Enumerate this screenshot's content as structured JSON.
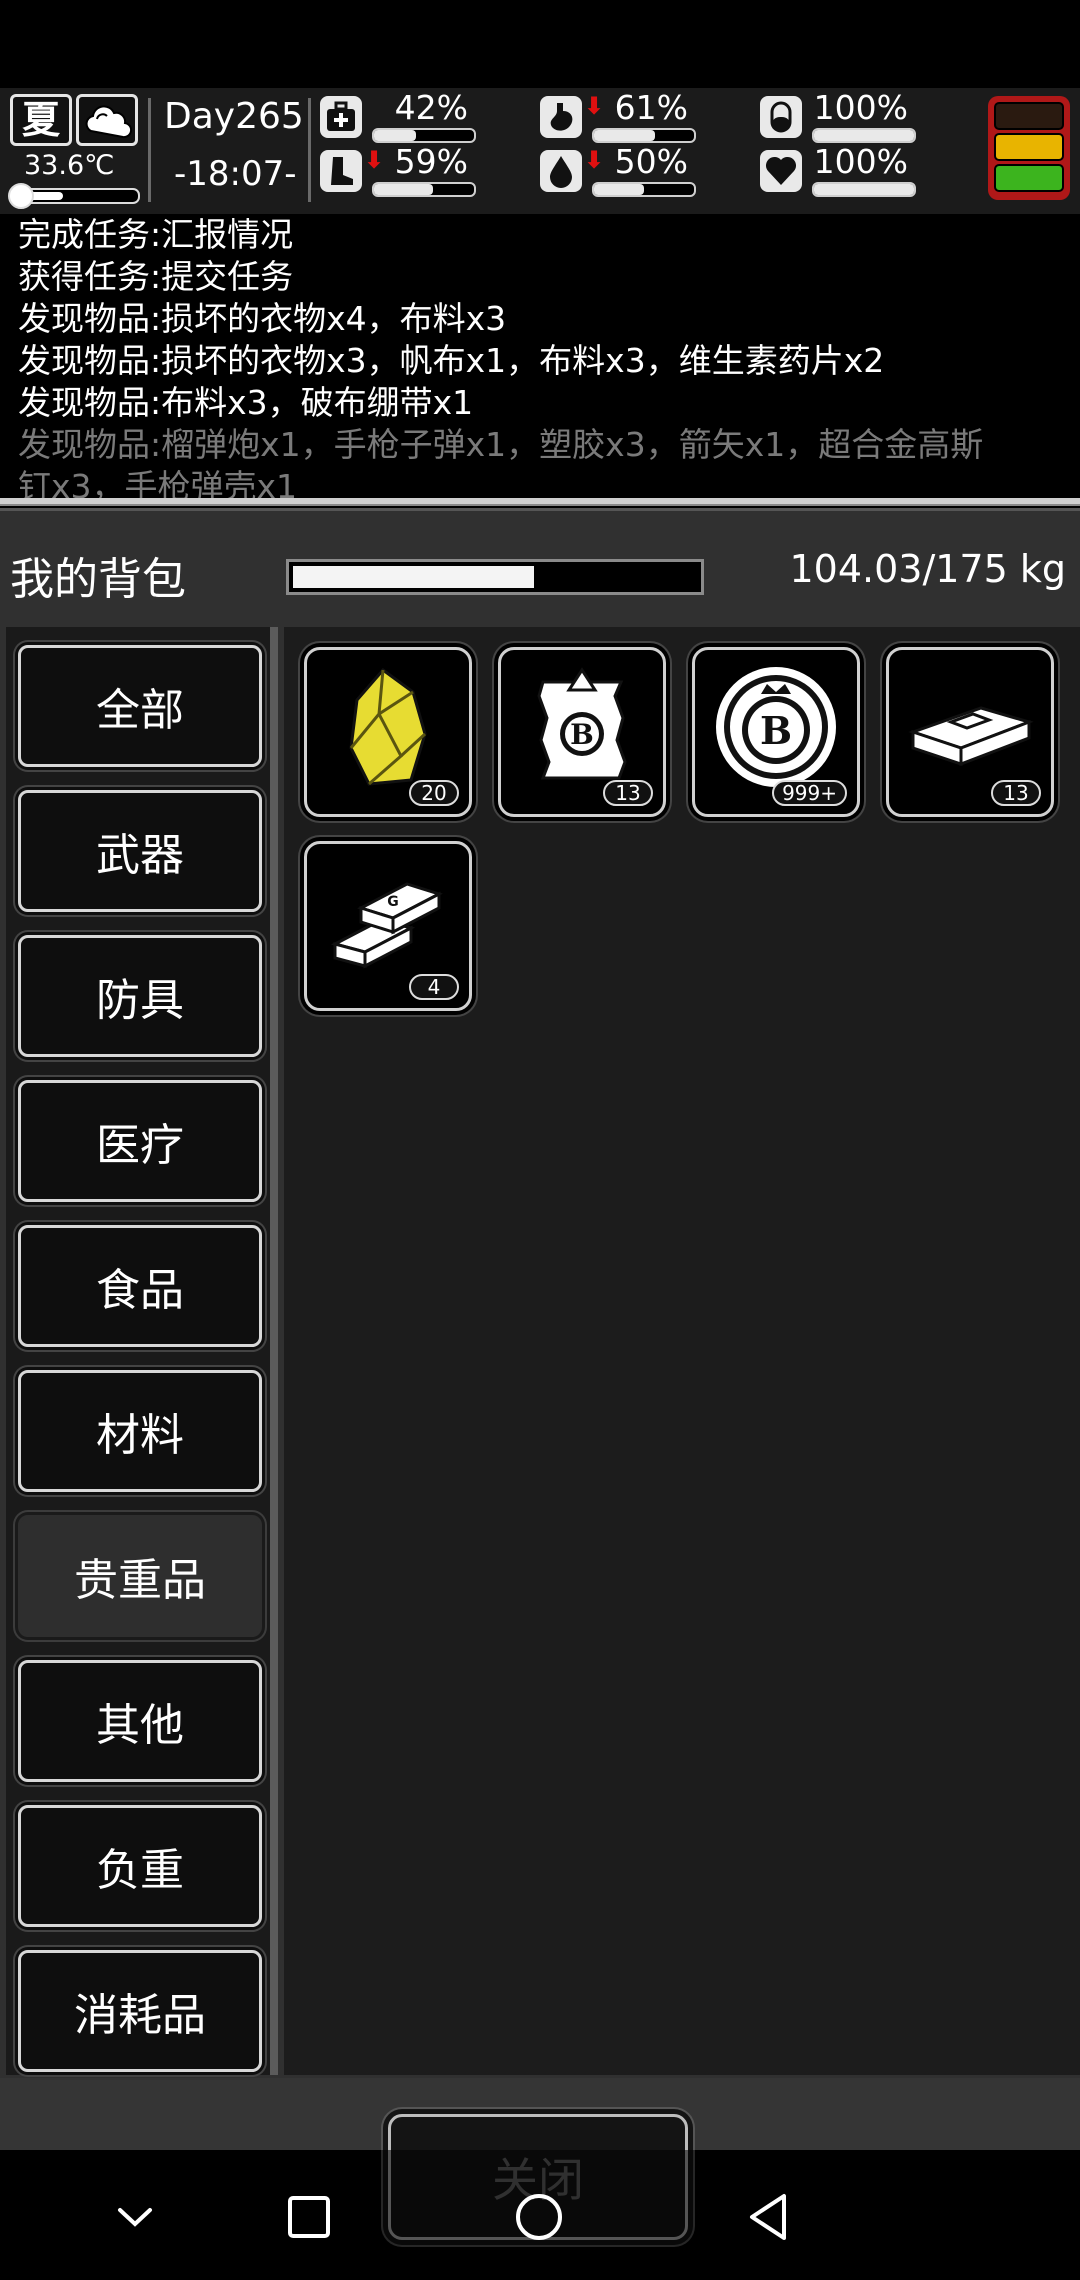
{
  "hud": {
    "season": "夏",
    "temperature": "33.6℃",
    "temperature_level": 0.4,
    "day": "Day265",
    "time": "-18:07-",
    "stats": [
      {
        "name": "health",
        "icon": "medkit-icon",
        "value": "42%",
        "level": 0.42,
        "dropping": false
      },
      {
        "name": "hunger",
        "icon": "stomach-icon",
        "value": "61%",
        "level": 0.61,
        "dropping": true
      },
      {
        "name": "medicine",
        "icon": "pill-icon",
        "value": "100%",
        "level": 1.0,
        "dropping": false
      },
      {
        "name": "stamina",
        "icon": "boot-icon",
        "value": "59%",
        "level": 0.59,
        "dropping": true
      },
      {
        "name": "thirst",
        "icon": "water-drop-icon",
        "value": "50%",
        "level": 0.5,
        "dropping": true
      },
      {
        "name": "mood",
        "icon": "heart-icon",
        "value": "100%",
        "level": 1.0,
        "dropping": false
      }
    ],
    "threat_colors": [
      "#2a1a10",
      "#e8b400",
      "#3cb41e"
    ]
  },
  "log": [
    {
      "text": "完成任务:汇报情况"
    },
    {
      "text": "获得任务:提交任务"
    },
    {
      "text": "发现物品:损坏的衣物x4，布料x3"
    },
    {
      "text": "发现物品:损坏的衣物x3，帆布x1，布料x3，维生素药片x2"
    },
    {
      "text": "发现物品:布料x3，破布绷带x1"
    },
    {
      "text": "发现物品:榴弹炮x1，手枪子弹x1，塑胶x3，箭矢x1，超合金高斯"
    },
    {
      "text": "钉x3，手枪弹壳x1"
    }
  ],
  "backpack": {
    "title": "我的背包",
    "weight": "104.03/175 kg",
    "weight_fraction": 0.594
  },
  "categories": [
    {
      "label": "全部",
      "active": false
    },
    {
      "label": "武器",
      "active": false
    },
    {
      "label": "防具",
      "active": false
    },
    {
      "label": "医疗",
      "active": false
    },
    {
      "label": "食品",
      "active": false
    },
    {
      "label": "材料",
      "active": false
    },
    {
      "label": "贵重品",
      "active": true
    },
    {
      "label": "其他",
      "active": false
    },
    {
      "label": "负重",
      "active": false
    },
    {
      "label": "消耗品",
      "active": false
    }
  ],
  "items": [
    {
      "icon": "gold-nugget-icon",
      "count": "20"
    },
    {
      "icon": "bitcoin-note-icon",
      "count": "13"
    },
    {
      "icon": "bitcoin-coin-icon",
      "count": "999+"
    },
    {
      "icon": "cash-bundle-icon",
      "count": "13"
    },
    {
      "icon": "gold-bars-icon",
      "count": "4"
    }
  ],
  "close_label": "关闭",
  "navbar": [
    "collapse-icon",
    "recents-icon",
    "home-icon",
    "back-icon"
  ]
}
